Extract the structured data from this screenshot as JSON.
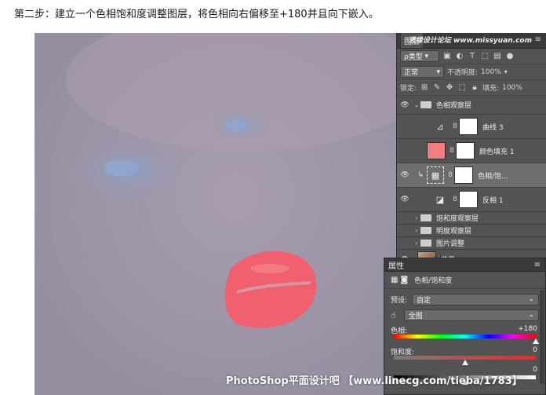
{
  "caption": "第二步：建立一个色相饱和度调整图层，将色相向右偏移至+180并且向下嵌入。",
  "layers_panel": {
    "tab": "图层",
    "site_mark": "思缘设计论坛 www.missyuan.com",
    "filter": "ρ类型",
    "blend_mode": "正常",
    "opacity_label": "不透明度:",
    "opacity_value": "100%",
    "lock_label": "锁定:",
    "fill_label": "填充:",
    "fill_value": "100%",
    "layers": [
      {
        "name": "色相观察层",
        "kind": "group-open",
        "visible": true
      },
      {
        "name": "曲线 3",
        "kind": "curves",
        "visible": false
      },
      {
        "name": "颜色填充 1",
        "kind": "fill",
        "visible": false
      },
      {
        "name": "色相/饱...",
        "kind": "hue-sat",
        "visible": true,
        "selected": true
      },
      {
        "name": "反相 1",
        "kind": "invert",
        "visible": true
      },
      {
        "name": "饱和度观察层",
        "kind": "group",
        "visible": false
      },
      {
        "name": "明度观察层",
        "kind": "group",
        "visible": false
      },
      {
        "name": "图片调整",
        "kind": "group",
        "visible": false
      },
      {
        "name": "背景",
        "kind": "background",
        "visible": true
      }
    ]
  },
  "properties_panel": {
    "tab": "属性",
    "adjust_title": "色相/饱和度",
    "preset_label": "预设:",
    "preset_value": "自定",
    "channel_value": "全图",
    "hue_label": "色相:",
    "hue_value": "+180",
    "hue_fraction": 1.0,
    "sat_label": "饱和度:",
    "sat_value": "0",
    "sat_fraction": 0.5,
    "light_value": "0",
    "light_fraction": 0.5
  },
  "colors": {
    "fill_swatch": "#f08080",
    "lips": "#f0606e"
  },
  "watermark": "PhotoShop平面设计吧 【www.linecg.com/tieba/1783】"
}
